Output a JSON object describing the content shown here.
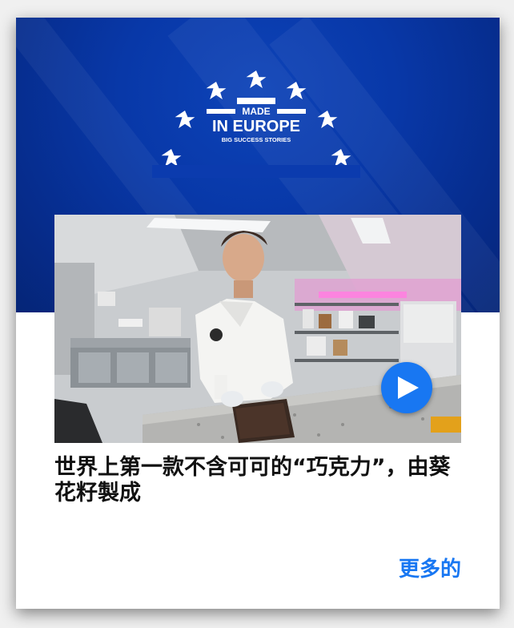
{
  "card": {
    "logo": {
      "line1": "MADE",
      "line2": "IN EUROPE",
      "tagline": "BIG SUCCESS STORIES",
      "icon": "eu-stars-logo"
    },
    "video": {
      "icon": "play-icon",
      "thumbnail": "chef-in-chocolate-kitchen"
    },
    "title": "世界上第一款不含可可的“巧克力”，由葵花籽製成",
    "more_label": "更多的"
  },
  "colors": {
    "banner_blue": "#0838a8",
    "accent_blue": "#1877f2",
    "text": "#111111"
  }
}
